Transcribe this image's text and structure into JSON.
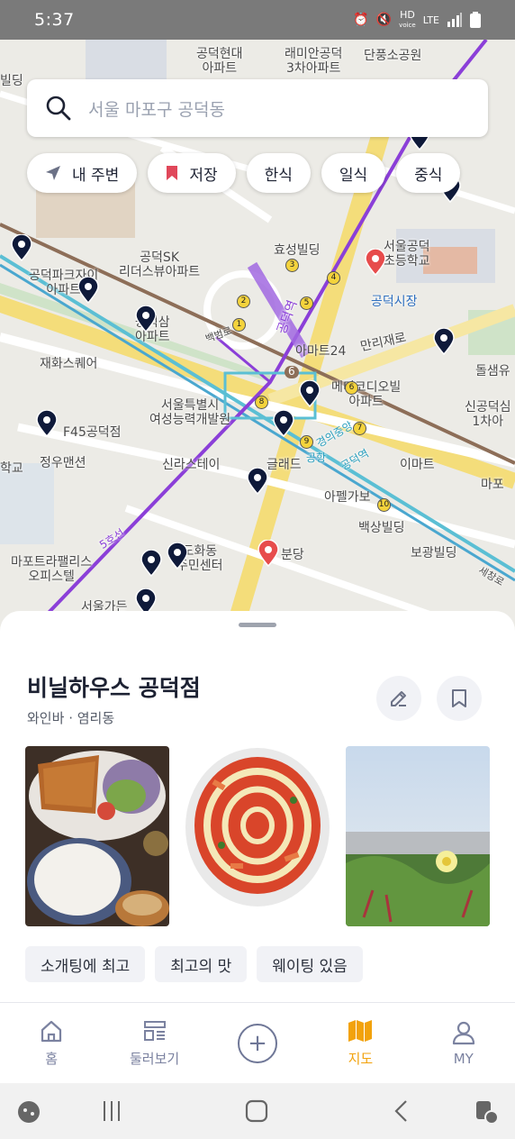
{
  "status_bar": {
    "time": "5:37",
    "network": "HD",
    "network_sub": "voice",
    "lte": "LTE"
  },
  "search": {
    "placeholder": "서울 마포구 공덕동"
  },
  "filters": [
    {
      "label": "내 주변",
      "icon": "location-arrow-icon"
    },
    {
      "label": "저장",
      "icon": "bookmark-icon"
    },
    {
      "label": "한식"
    },
    {
      "label": "일식"
    },
    {
      "label": "중식"
    }
  ],
  "map": {
    "labels": {
      "gongdeok_hyundai": "공덕현대\n아파트",
      "raemian3": "래미안공덕\n3차아파트",
      "dansogong": "단풍소공원",
      "bldg_left": "빌딩",
      "hyoseong": "효성빌딩",
      "gongdeok_elem": "서울공덕\n초등학교",
      "gongdeok_sk": "공덕SK\n리더스뷰아파트",
      "gongdeok_park": "공덕파크자이\n아파트",
      "gongdeok_market": "공덕시장",
      "gongdeok_sam": "공덕삼\n아파트",
      "jaehwa": "재화스퀘어",
      "mart24": "아마트24",
      "manri": "만리재로",
      "doryou": "돌샘유",
      "medic": "메디코디오빌\n아파트",
      "seoul_women": "서울특별시\n여성능력개발원",
      "sinkong": "신공덕심\n1차아",
      "f45": "F45공덕점",
      "jeongwoo": "정우맨션",
      "shinlastay": "신라스테이",
      "glad": "글래드",
      "emart": "이마트",
      "mapo_left": "마포",
      "school_left": "학교",
      "apelgabo": "아펠가보",
      "baeksang": "백상빌딩",
      "bogwang": "보광빌딩",
      "dohwa": "도화동\n주민센터",
      "bundang": "분당",
      "mapo_trapalace": "마포트라팰리스\n오피스텔",
      "seoulga": "서울가든",
      "gongdeok_station": "공덕역",
      "airport": "공항",
      "line5": "5호선",
      "line6": "6",
      "line_road": "백범로",
      "gyeongui": "경의중앙",
      "gongdeok_station2": "공덕역",
      "sejong": "세창로"
    },
    "exit_numbers": [
      "2",
      "1",
      "3",
      "4",
      "5",
      "6",
      "7",
      "8",
      "9",
      "10"
    ]
  },
  "place": {
    "name": "비닐하우스 공덕점",
    "category": "와인바",
    "separator": "·",
    "area": "염리동",
    "tags": [
      "소개팅에 최고",
      "최고의 맛",
      "웨이팅 있음"
    ]
  },
  "bottom_nav": [
    {
      "label": "홈",
      "icon": "home-icon"
    },
    {
      "label": "둘러보기",
      "icon": "browse-icon"
    },
    {
      "label": "",
      "icon": "plus-icon"
    },
    {
      "label": "지도",
      "icon": "map-icon",
      "active": true
    },
    {
      "label": "MY",
      "icon": "user-icon"
    }
  ],
  "colors": {
    "accent": "#f2a20c",
    "nav": "#7b82a0",
    "pin": "#0f1a3a",
    "pin_red": "#e74c4c",
    "line5": "#8b3fd8"
  }
}
